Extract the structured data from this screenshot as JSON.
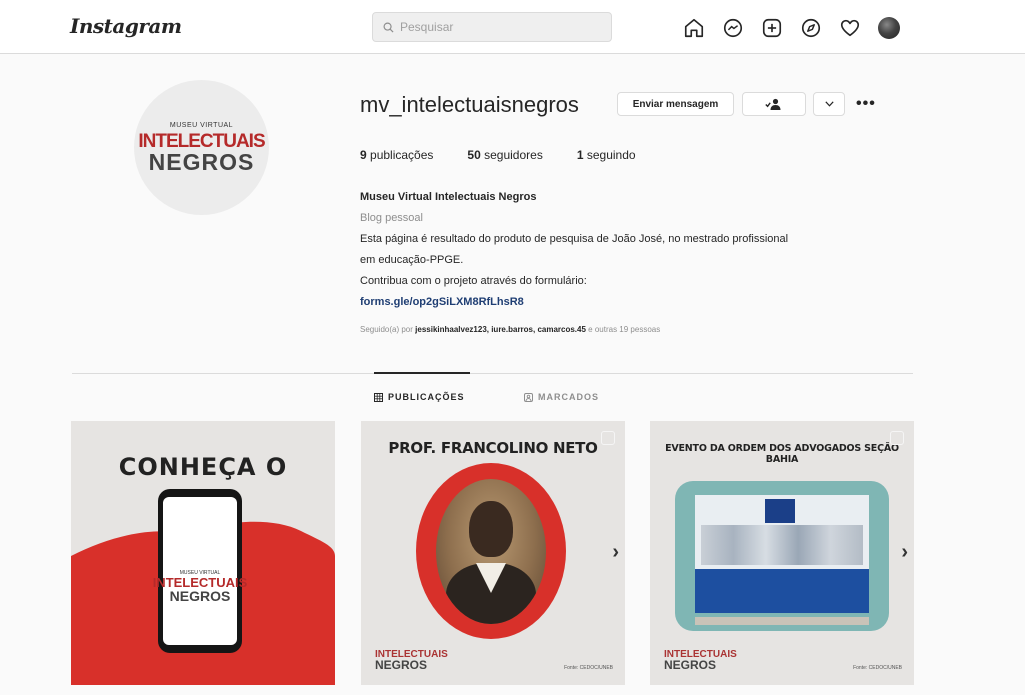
{
  "nav": {
    "logo": "Instagram",
    "search_placeholder": "Pesquisar",
    "icons": [
      "home-icon",
      "messenger-icon",
      "new-post-icon",
      "explore-icon",
      "activity-heart-icon",
      "profile-avatar"
    ]
  },
  "profile": {
    "username": "mv_intelectuaisnegros",
    "pfp_text": {
      "small": "MUSEU VIRTUAL",
      "line1": "INTELECTUAIS",
      "line2": "NEGROS"
    },
    "buttons": {
      "message": "Enviar mensagem",
      "more": "•••"
    },
    "stats": {
      "posts_count": "9",
      "posts_label": "publicações",
      "followers_count": "50",
      "followers_label": "seguidores",
      "following_count": "1",
      "following_label": "seguindo"
    },
    "bio": {
      "name": "Museu Virtual Intelectuais Negros",
      "category": "Blog pessoal",
      "line1": "Esta página é resultado do produto de pesquisa de João José, no mestrado profissional",
      "line2": "em educação-PPGE.",
      "line3": "Contribua com o projeto através do formulário:",
      "link": "forms.gle/op2gSiLXM8RfLhsR8"
    },
    "followed_by": {
      "prefix": "Seguido(a) por",
      "names": "jessikinhaalvez123, iure.barros, camarcos.45",
      "suffix": "e outras 19 pessoas"
    }
  },
  "tabs": {
    "posts": "PUBLICAÇÕES",
    "tagged": "MARCADOS"
  },
  "posts": [
    {
      "title": "CONHEÇA O",
      "phone_small": "MUSEU VIRTUAL",
      "phone_line1": "INTELECTUAIS",
      "phone_line2": "NEGROS"
    },
    {
      "title": "PROF. FRANCOLINO NETO",
      "logo_a": "INTELECTUAIS",
      "logo_b": "NEGROS",
      "fonte": "Fonte: CEDOC/UNEB"
    },
    {
      "title": "EVENTO DA ORDEM DOS ADVOGADOS SEÇÃO BAHIA",
      "logo_a": "INTELECTUAIS",
      "logo_b": "NEGROS",
      "fonte": "Fonte: CEDOC/UNEB"
    }
  ],
  "colors": {
    "accent_red": "#d8302a",
    "link_blue": "#1f3e73",
    "teal_frame": "#7fb6b4",
    "banner_blue": "#1d4fa0"
  }
}
